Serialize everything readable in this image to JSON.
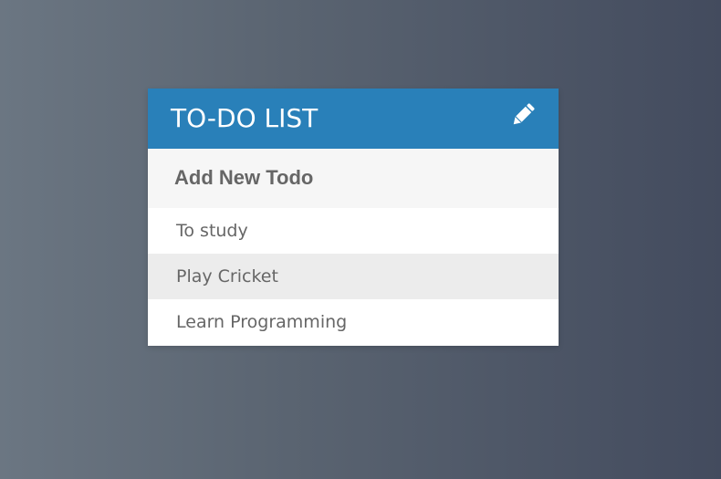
{
  "card": {
    "title": "TO-DO LIST",
    "edit_icon": "pencil-icon",
    "header_color": "#2980b9"
  },
  "add_todo": {
    "placeholder": "Add New Todo"
  },
  "todos": [
    {
      "text": "To study"
    },
    {
      "text": "Play Cricket"
    },
    {
      "text": "Learn Programming"
    }
  ]
}
